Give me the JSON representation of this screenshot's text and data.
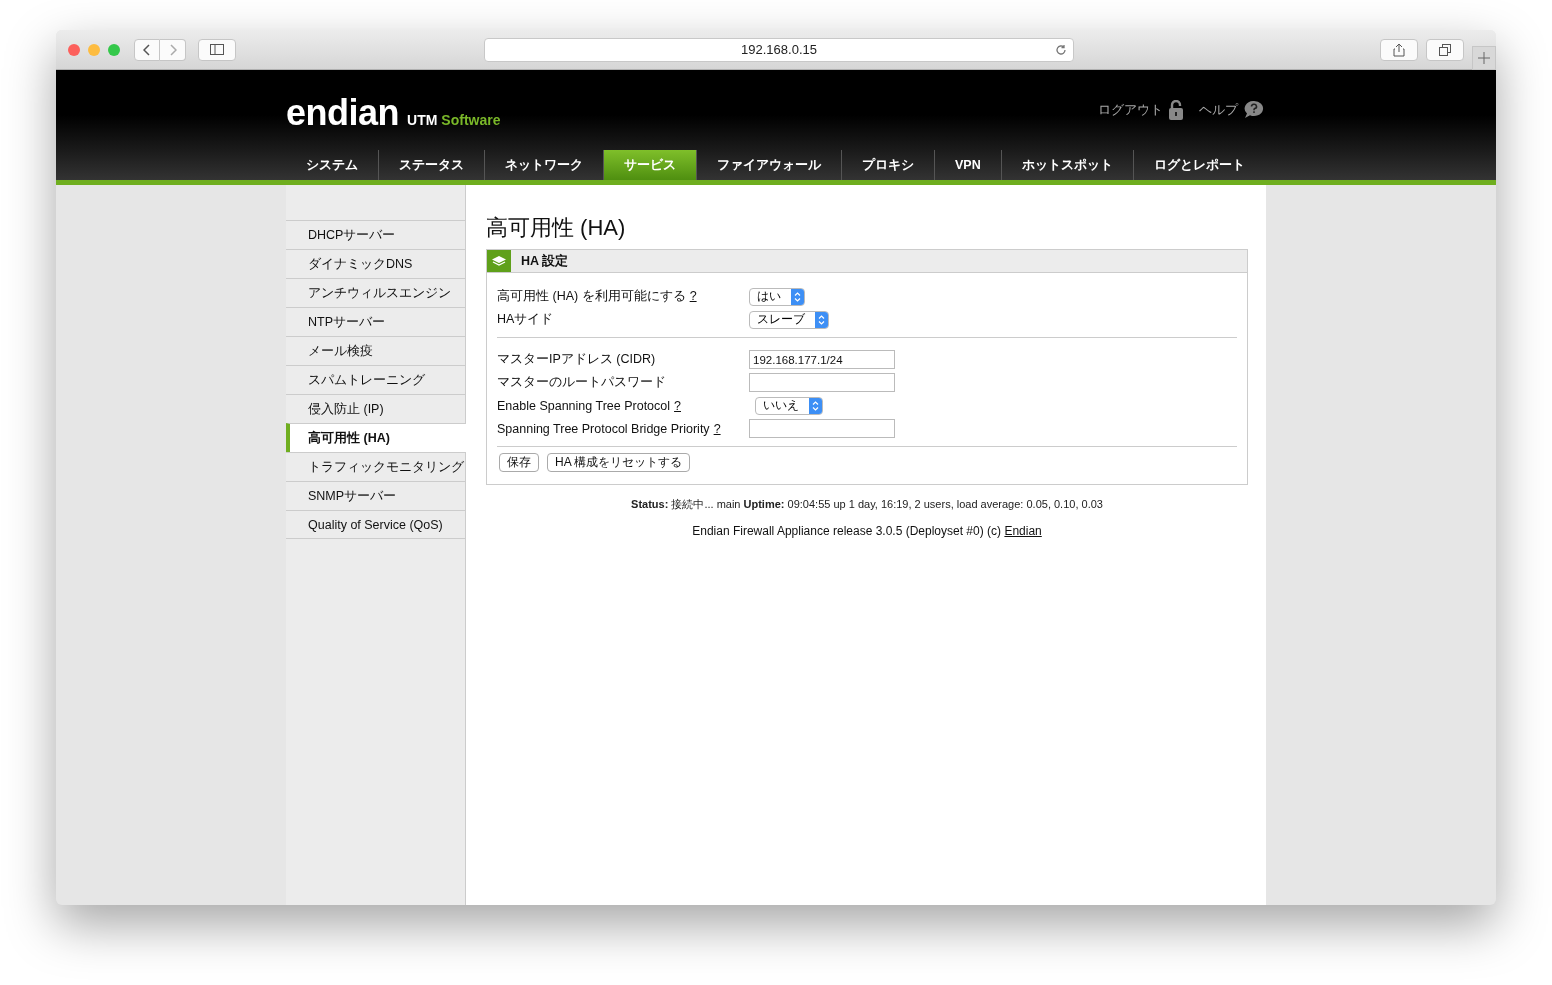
{
  "browser": {
    "url": "192.168.0.15"
  },
  "header": {
    "logo": "endian",
    "logo_sub": "UTM",
    "logo_product": "Software",
    "links": [
      {
        "label": "ログアウト",
        "kind": "logout"
      },
      {
        "label": "ヘルプ",
        "kind": "help"
      }
    ]
  },
  "nav": [
    {
      "label": "システム",
      "selected": false
    },
    {
      "label": "ステータス",
      "selected": false
    },
    {
      "label": "ネットワーク",
      "selected": false
    },
    {
      "label": "サービス",
      "selected": true
    },
    {
      "label": "ファイアウォール",
      "selected": false
    },
    {
      "label": "プロキシ",
      "selected": false
    },
    {
      "label": "VPN",
      "selected": false
    },
    {
      "label": "ホットスポット",
      "selected": false
    },
    {
      "label": "ログとレポート",
      "selected": false
    }
  ],
  "sidebar": {
    "items": [
      {
        "label": "DHCPサーバー",
        "selected": false
      },
      {
        "label": "ダイナミックDNS",
        "selected": false
      },
      {
        "label": "アンチウィルスエンジン",
        "selected": false
      },
      {
        "label": "NTPサーバー",
        "selected": false
      },
      {
        "label": "メール検疫",
        "selected": false
      },
      {
        "label": "スパムトレーニング",
        "selected": false
      },
      {
        "label": "侵入防止 (IP)",
        "selected": false
      },
      {
        "label": "高可用性 (HA)",
        "selected": true
      },
      {
        "label": "トラフィックモニタリング",
        "selected": false
      },
      {
        "label": "SNMPサーバー",
        "selected": false
      },
      {
        "label": "Quality of Service (QoS)",
        "selected": false
      }
    ]
  },
  "page_title": "高可用性 (HA)",
  "panel": {
    "title": "HA 設定",
    "groups": [
      [
        {
          "kind": "select",
          "label": "高可用性 (HA) を利用可能にする",
          "help": "?",
          "value": "はい"
        },
        {
          "kind": "select",
          "label": "HAサイド",
          "value": "スレーブ"
        }
      ],
      [
        {
          "kind": "text",
          "label": "マスターIPアドレス (CIDR)",
          "value": "192.168.177.1/24"
        },
        {
          "kind": "password",
          "label": "マスターのルートパスワード"
        },
        {
          "kind": "select",
          "label": "Enable Spanning Tree Protocol",
          "help": "?",
          "value": "いいえ"
        },
        {
          "kind": "text",
          "label": "Spanning Tree Protocol Bridge Priority",
          "help": "?"
        }
      ]
    ],
    "buttons": [
      "保存",
      "HA 構成をリセットする"
    ]
  },
  "status": "**Status:** 接続中... main **Uptime:** 09:04:55 up 1 day, 16:19, 2 users, load average: 0.05, 0.10, 0.03",
  "footer": {
    "text": "Endian Firewall Appliance release 3.0.5 (Deployset #0) (c)",
    "link": "Endian"
  }
}
